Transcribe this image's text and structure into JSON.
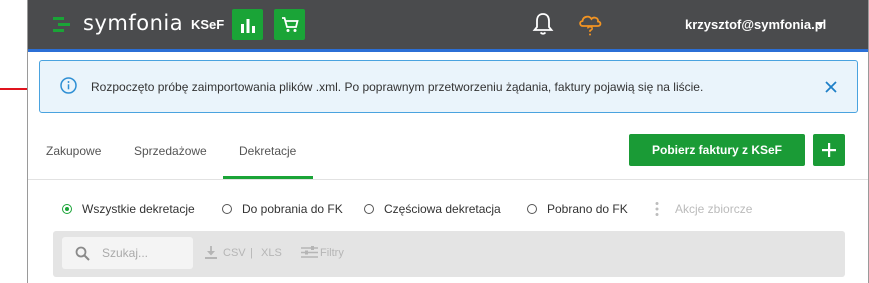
{
  "header": {
    "brand": "symfonia",
    "module_label": "KSeF",
    "user_email": "krzysztof@symfonia.pl"
  },
  "alert": {
    "message": "Rozpoczęto próbę zaimportowania plików .xml. Po poprawnym przetworzeniu żądania, faktury pojawią się na liście."
  },
  "tabs": [
    {
      "label": "Zakupowe"
    },
    {
      "label": "Sprzedażowe"
    },
    {
      "label": "Dekretacje",
      "active": true
    }
  ],
  "actions": {
    "fetch_label": "Pobierz faktury z KSeF",
    "add_label": "+"
  },
  "filters": [
    {
      "label": "Wszystkie dekretacje",
      "selected": true
    },
    {
      "label": "Do pobrania do FK",
      "selected": false
    },
    {
      "label": "Częściowa dekretacja",
      "selected": false
    },
    {
      "label": "Pobrano do FK",
      "selected": false
    }
  ],
  "bulk_actions_label": "Akcje zbiorcze",
  "toolbar": {
    "search_placeholder": "Szukaj...",
    "csv_label": "CSV",
    "separator": "|",
    "xls_label": "XLS",
    "filters_label": "Filtry"
  },
  "colors": {
    "topbar": "#4a4b4d",
    "accent_green": "#1aa437",
    "alert_border": "#4aa3df",
    "alert_bg": "#eaf4fb",
    "pointer_arrow": "#e0141e",
    "cloud_icon": "#f29423"
  },
  "icons": [
    "symfonia-logo-icon",
    "chart-icon",
    "cart-icon",
    "bell-icon",
    "cloud-help-icon",
    "info-icon",
    "close-icon",
    "search-icon",
    "download-icon",
    "filter-icon",
    "kebab-icon"
  ]
}
